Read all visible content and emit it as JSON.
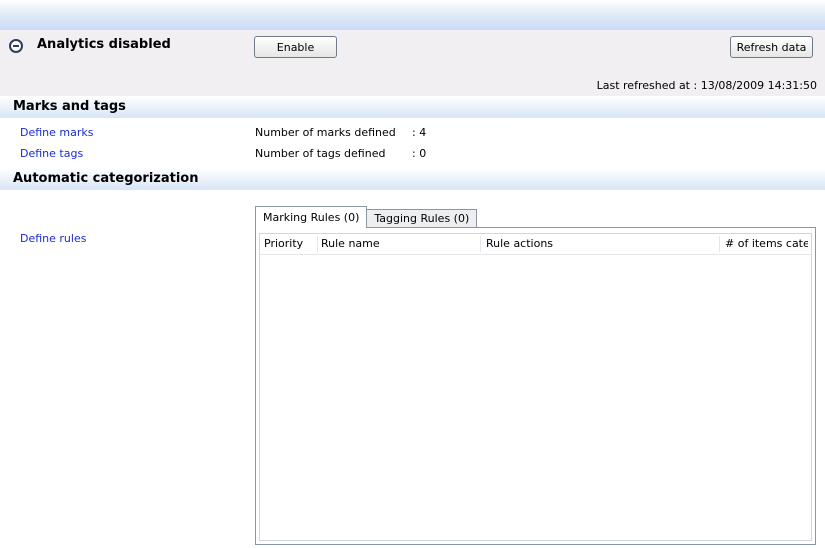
{
  "status": {
    "icon": "minus-circle-icon",
    "text": "Analytics disabled",
    "enable_label": "Enable",
    "refresh_label": "Refresh data",
    "last_refreshed": "Last refreshed at : 13/08/2009 14:31:50"
  },
  "marks_tags": {
    "title": "Marks and tags",
    "define_marks": "Define marks",
    "define_tags": "Define tags",
    "marks_label": "Number of marks defined",
    "marks_value": ": 4",
    "tags_label": "Number of tags defined",
    "tags_value": ": 0"
  },
  "auto": {
    "title": "Automatic categorization",
    "define_rules": "Define rules",
    "tabs": [
      "Marking Rules (0)",
      "Tagging Rules (0)"
    ],
    "columns": [
      "Priority",
      "Rule name",
      "Rule actions",
      "# of items cate"
    ]
  },
  "colors": {
    "link": "#1b2bd4",
    "header_gradient": "#d8e5f6",
    "status_bg": "#f1eff1"
  }
}
